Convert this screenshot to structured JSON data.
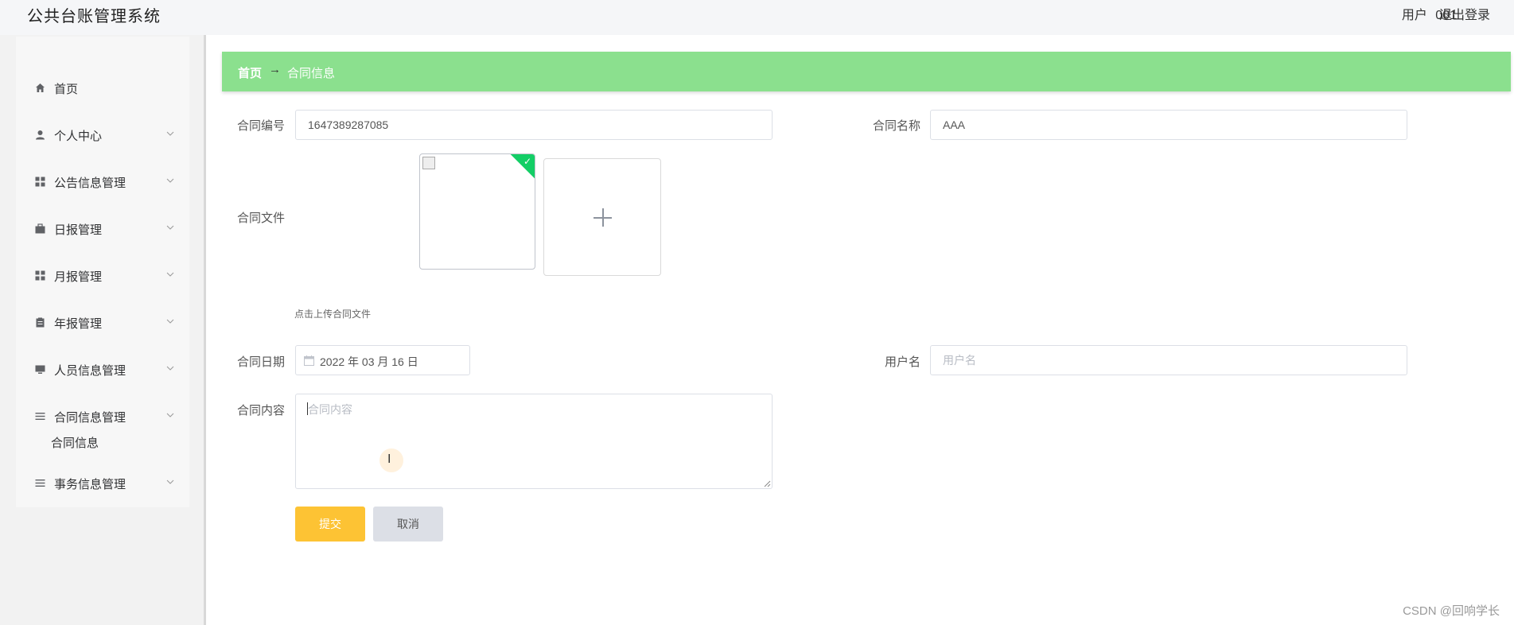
{
  "app": {
    "title": "公共台账管理系统"
  },
  "header": {
    "user_label": "用户",
    "user_name": "001",
    "logout_label": "退出登录"
  },
  "sidebar": {
    "items": [
      {
        "label": "首页",
        "icon": "home-icon"
      },
      {
        "label": "个人中心",
        "icon": "user-icon"
      },
      {
        "label": "公告信息管理",
        "icon": "grid-icon"
      },
      {
        "label": "日报管理",
        "icon": "briefcase-icon"
      },
      {
        "label": "月报管理",
        "icon": "grid-icon"
      },
      {
        "label": "年报管理",
        "icon": "clipboard-icon"
      },
      {
        "label": "人员信息管理",
        "icon": "monitor-icon"
      },
      {
        "label": "合同信息管理",
        "icon": "list-icon"
      },
      {
        "label": "事务信息管理",
        "icon": "list-icon"
      }
    ],
    "subitem": {
      "label": "合同信息"
    }
  },
  "breadcrumb": {
    "home": "首页",
    "arrow": "→",
    "current": "合同信息"
  },
  "form": {
    "contract_no": {
      "label": "合同编号",
      "value": "1647389287085"
    },
    "contract_name": {
      "label": "合同名称",
      "value": "AAA"
    },
    "contract_file": {
      "label": "合同文件",
      "tip": "点击上传合同文件"
    },
    "contract_date": {
      "label": "合同日期",
      "value": "2022 年 03 月 16 日"
    },
    "username": {
      "label": "用户名",
      "placeholder": "用户名"
    },
    "contract_content": {
      "label": "合同内容",
      "placeholder": "合同内容"
    }
  },
  "buttons": {
    "submit": "提交",
    "cancel": "取消"
  },
  "colors": {
    "breadcrumb_bg": "#8be08e",
    "submit_bg": "#fdc334",
    "cancel_bg": "#dcdfe6",
    "success_corner": "#13ce66"
  },
  "watermark": "CSDN @回响学长"
}
